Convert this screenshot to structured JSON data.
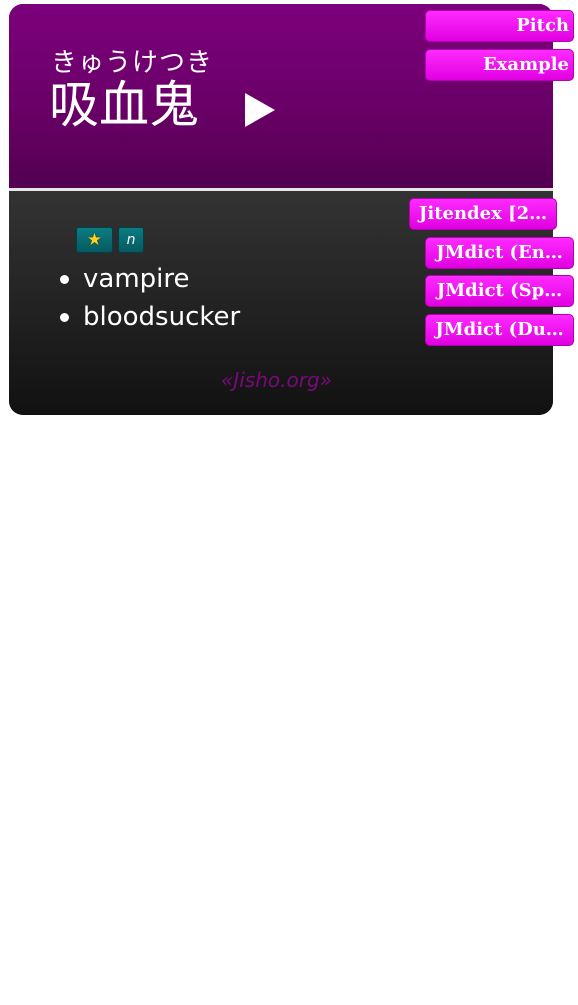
{
  "card": {
    "reading": "きゅうけつき",
    "headword": "吸血鬼",
    "play_icon": "play-icon",
    "tags": {
      "common_icon": "star-icon",
      "common_symbol": "★",
      "pos": "n"
    },
    "glosses": [
      "vampire",
      "bloodsucker"
    ],
    "source": "«Jisho.org»"
  },
  "buttons": {
    "pitch": "Pitch",
    "example": "Example",
    "jitendex": "Jitendex [2…",
    "jmdict_en": "JMdict (En…",
    "jmdict_sp": "JMdict (Sp…",
    "jmdict_du": "JMdict (Du…"
  },
  "colors": {
    "header_purple": "#6a0068",
    "button_magenta": "#f010f0",
    "tag_teal": "#0a7c82",
    "star_yellow": "#ffd11a",
    "source_link": "#7a0a7a"
  }
}
